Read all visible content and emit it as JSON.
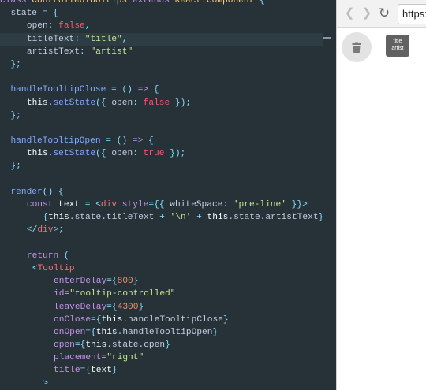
{
  "editor": {
    "lines": [
      "class ControlledTooltips extends React.Component {",
      "  state = {",
      "    open: false,",
      "    titleText: \"title\",",
      "    artistText: \"artist\"",
      "  };",
      "",
      "  handleTooltipClose = () => {",
      "    this.setState({ open: false });",
      "  };",
      "",
      "  handleTooltipOpen = () => {",
      "    this.setState({ open: true });",
      "  };",
      "",
      "  render() {",
      "    const text = <div style={{ whiteSpace: 'pre-line' }}>",
      "      {this.state.titleText + '\\n' + this.state.artistText}",
      "    </div>;",
      "",
      "    return (",
      "      <Tooltip",
      "        enterDelay={800}",
      "        id=\"tooltip-controlled\"",
      "        leaveDelay={4300}",
      "        onClose={this.handleTooltipClose}",
      "        onOpen={this.handleTooltipOpen}",
      "        open={this.state.open}",
      "        placement=\"right\"",
      "        title={text}",
      "      >"
    ]
  },
  "browser": {
    "back_icon": "chevron-left-icon",
    "forward_icon": "chevron-right-icon",
    "reload_icon": "reload-icon",
    "url": "https:",
    "button_icon": "trash-icon",
    "tooltip_title": "title",
    "tooltip_artist": "artist"
  },
  "colors": {
    "editor_bg": "#263238",
    "tooltip_bg": "#616161",
    "keyword": "#c792ea",
    "string": "#c3e88d",
    "number": "#f78c6c",
    "function": "#82aaff",
    "tag": "#f07178"
  }
}
